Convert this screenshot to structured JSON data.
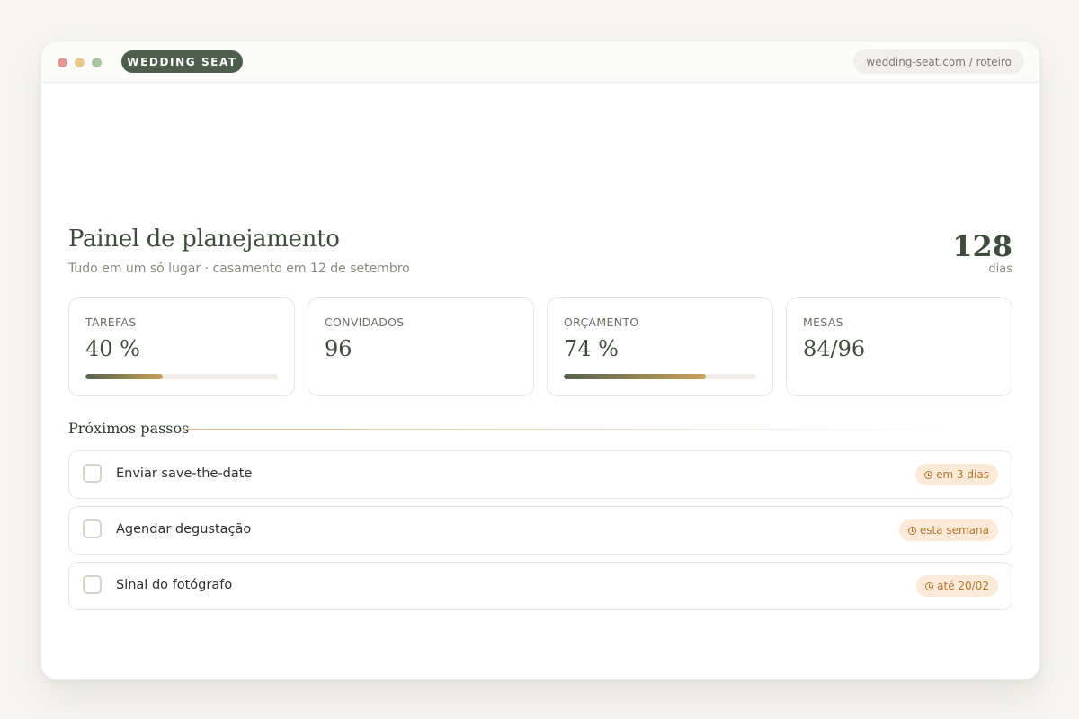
{
  "window": {
    "brand": "WEDDING SEAT",
    "url": "wedding-seat.com / roteiro"
  },
  "header": {
    "title": "Painel de planejamento",
    "subtitle": "Tudo em um só lugar · casamento em 12 de setembro",
    "countdown_value": "128",
    "countdown_unit": "dias"
  },
  "stats": [
    {
      "label": "TAREFAS",
      "value": "40 %",
      "progress": 0.4
    },
    {
      "label": "CONVIDADOS",
      "value": "96"
    },
    {
      "label": "ORÇAMENTO",
      "value": "74 %",
      "progress": 0.74
    },
    {
      "label": "MESAS",
      "value": "84/96"
    }
  ],
  "next_steps": {
    "title": "Próximos passos",
    "items": [
      {
        "label": "Enviar save-the-date",
        "due": "em 3 dias",
        "done": false
      },
      {
        "label": "Agendar degustação",
        "due": "esta semana",
        "done": false
      },
      {
        "label": "Sinal do fotógrafo",
        "due": "até 20/02",
        "done": false
      }
    ]
  },
  "colors": {
    "brand": "#4d5e4c",
    "heading": "#3f4b3c",
    "accent_gold": "#c9a25a",
    "due_badge_bg": "#fbead7",
    "due_badge_text": "#b3742f"
  },
  "icons": [
    "window-close-dot",
    "window-minimize-dot",
    "window-maximize-dot",
    "clock-icon",
    "checkbox"
  ]
}
